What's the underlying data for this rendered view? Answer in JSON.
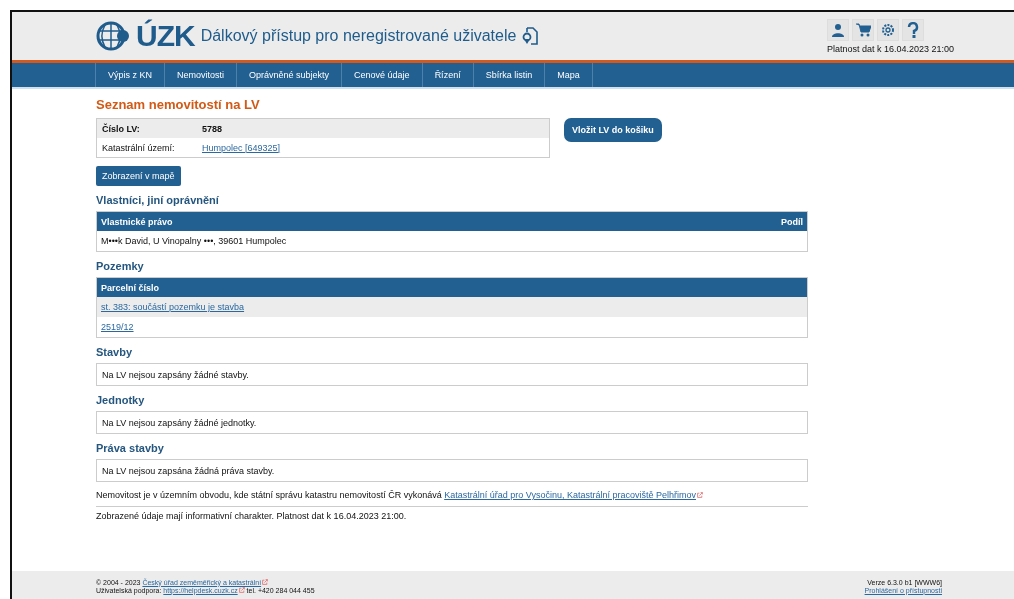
{
  "header": {
    "logo_text": "ÚZK",
    "title": "Dálkový přístup pro neregistrované uživatele",
    "validity": "Platnost dat k 16.04.2023 21:00"
  },
  "nav": [
    {
      "label": "Výpis z KN"
    },
    {
      "label": "Nemovitosti"
    },
    {
      "label": "Oprávněné subjekty"
    },
    {
      "label": "Cenové údaje"
    },
    {
      "label": "Řízení"
    },
    {
      "label": "Sbírka listin"
    },
    {
      "label": "Mapa"
    }
  ],
  "page_title": "Seznam nemovitostí na LV",
  "lv_info": [
    {
      "label": "Číslo LV:",
      "value": "5788",
      "kind": "text"
    },
    {
      "label": "Katastrální území:",
      "value": "Humpolec [649325]",
      "kind": "link"
    }
  ],
  "cart_button": "Vložit LV do košiku",
  "map_button": "Zobrazení v mapě",
  "owners": {
    "title": "Vlastníci, jiní oprávnění",
    "columns": [
      "Vlastnické právo",
      "Podíl"
    ],
    "rows": [
      "M•••k David, U Vinopalny •••, 39601 Humpolec"
    ]
  },
  "parcels": {
    "title": "Pozemky",
    "column": "Parcelní číslo",
    "rows": [
      "st. 383: součástí pozemku je stavba",
      "2519/12"
    ]
  },
  "empty_sections": [
    {
      "title": "Stavby",
      "text": "Na LV nejsou zapsány žádné stavby."
    },
    {
      "title": "Jednotky",
      "text": "Na LV nejsou zapsány žádné jednotky."
    },
    {
      "title": "Práva stavby",
      "text": "Na LV nejsou zapsána žádná práva stavby."
    }
  ],
  "office_note": {
    "text": "Nemovitost je v územním obvodu, kde státní správu katastru nemovitostí ČR vykonává",
    "link": "Katastrální úřad pro Vysočinu, Katastrální pracoviště Pelhřimov"
  },
  "disclaimer": "Zobrazené údaje mají informativní charakter. Platnost dat k 16.04.2023 21:00.",
  "footer": {
    "copyright": "© 2004 - 2023",
    "copyright_link": "Český úřad zeměměřický a katastrální",
    "support": "Uživatelská podpora:",
    "support_link": "https://helpdesk.cuzk.cz",
    "phone": "tel. +420 284 044 455",
    "version": "Verze 6.3.0 b1 [WWW6]",
    "accessibility_link": "Prohlášení o přístupnosti"
  }
}
